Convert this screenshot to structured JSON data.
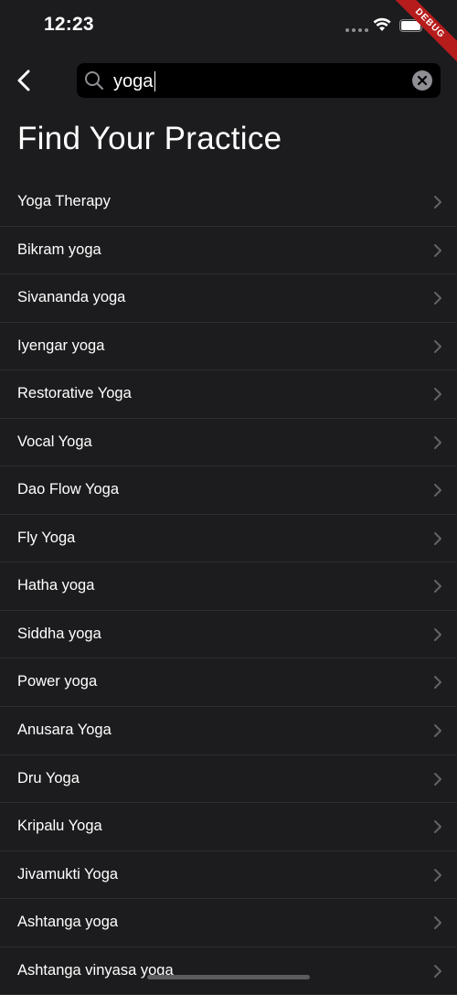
{
  "status_bar": {
    "time": "12:23"
  },
  "debug_banner": "DEBUG",
  "search": {
    "value": "yoga"
  },
  "page_title": "Find Your Practice",
  "items": [
    "Yoga Therapy",
    "Bikram yoga",
    "Sivananda yoga",
    "Iyengar yoga",
    "Restorative Yoga",
    "Vocal Yoga",
    "Dao Flow Yoga",
    "Fly Yoga",
    "Hatha yoga",
    "Siddha yoga",
    "Power yoga",
    "Anusara Yoga",
    "Dru Yoga",
    "Kripalu Yoga",
    "Jivamukti Yoga",
    "Ashtanga yoga",
    "Ashtanga vinyasa yoga"
  ],
  "icons": {
    "back": "chevron-left-icon",
    "search": "search-icon",
    "clear": "clear-icon",
    "row": "chevron-right-icon"
  },
  "colors": {
    "background": "#1c1c1e",
    "search_bg": "#000000",
    "separator": "#2e2e31",
    "chevron": "#636366"
  }
}
